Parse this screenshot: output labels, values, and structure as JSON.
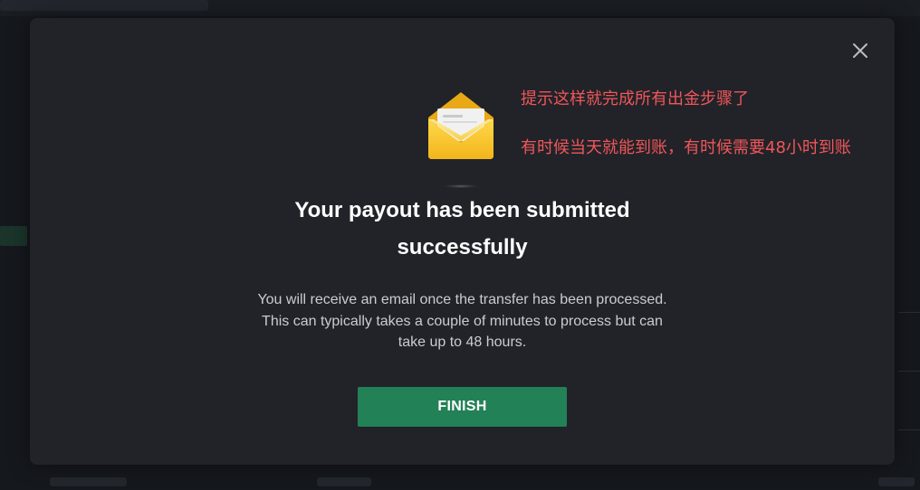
{
  "annotation": {
    "line1": "提示这样就完成所有出金步骤了",
    "line2": "有时候当天就能到账，有时候需要48小时到账"
  },
  "modal": {
    "title": "Your payout has been submitted successfully",
    "message": "You will receive an email once the transfer has been processed. This can typically takes a couple of minutes to process but can take up to 48 hours.",
    "finish_label": "FINISH",
    "icons": {
      "close": "close-icon",
      "envelope": "envelope-icon"
    }
  },
  "colors": {
    "modal_bg": "#212328",
    "page_bg": "#15181d",
    "finish_button": "#228157",
    "annotation_text": "#f0565a",
    "envelope": "#f5c52c"
  }
}
